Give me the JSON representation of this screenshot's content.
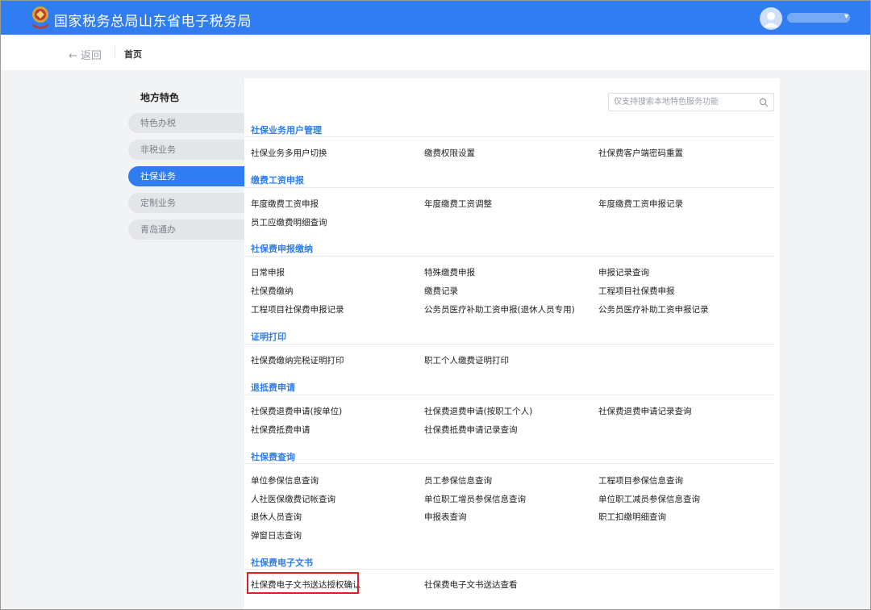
{
  "header": {
    "brand": "国家税务总局山东省电子税务局"
  },
  "breadcrumb": {
    "back_label": "← 返回",
    "home_label": "首页"
  },
  "sidebar": {
    "title": "地方特色",
    "items": [
      {
        "label": "特色办税"
      },
      {
        "label": "非税业务"
      },
      {
        "label": "社保业务"
      },
      {
        "label": "定制业务"
      },
      {
        "label": "青岛通办"
      }
    ]
  },
  "search": {
    "placeholder": "仅支持搜索本地特色服务功能"
  },
  "sections": [
    {
      "title": "社保业务用户管理",
      "items": [
        "社保业务多用户切换",
        "缴费权限设置",
        "社保费客户端密码重置"
      ]
    },
    {
      "title": "缴费工资申报",
      "items": [
        "年度缴费工资申报",
        "年度缴费工资调整",
        "年度缴费工资申报记录",
        "员工应缴费明细查询"
      ]
    },
    {
      "title": "社保费申报缴纳",
      "items": [
        "日常申报",
        "特殊缴费申报",
        "申报记录查询",
        "社保费缴纳",
        "缴费记录",
        "工程项目社保费申报",
        "工程项目社保费申报记录",
        "公务员医疗补助工资申报(退休人员专用)",
        "公务员医疗补助工资申报记录"
      ]
    },
    {
      "title": "证明打印",
      "items": [
        "社保费缴纳完税证明打印",
        "职工个人缴费证明打印"
      ]
    },
    {
      "title": "退抵费申请",
      "items": [
        "社保费退费申请(按单位)",
        "社保费退费申请(按职工个人)",
        "社保费退费申请记录查询",
        "社保费抵费申请",
        "社保费抵费申请记录查询"
      ]
    },
    {
      "title": "社保费查询",
      "items": [
        "单位参保信息查询",
        "员工参保信息查询",
        "工程项目参保信息查询",
        "人社医保缴费记帐查询",
        "单位职工增员参保信息查询",
        "单位职工减员参保信息查询",
        "退休人员查询",
        "申报表查询",
        "职工扣缴明细查询",
        "弹窗日志查询"
      ]
    },
    {
      "title": "社保费电子文书",
      "items": [
        "社保费电子文书送达授权确认",
        "社保费电子文书送达查看"
      ]
    }
  ],
  "colors": {
    "brand_blue": "#2f7df0",
    "highlight_red": "#e02020"
  }
}
